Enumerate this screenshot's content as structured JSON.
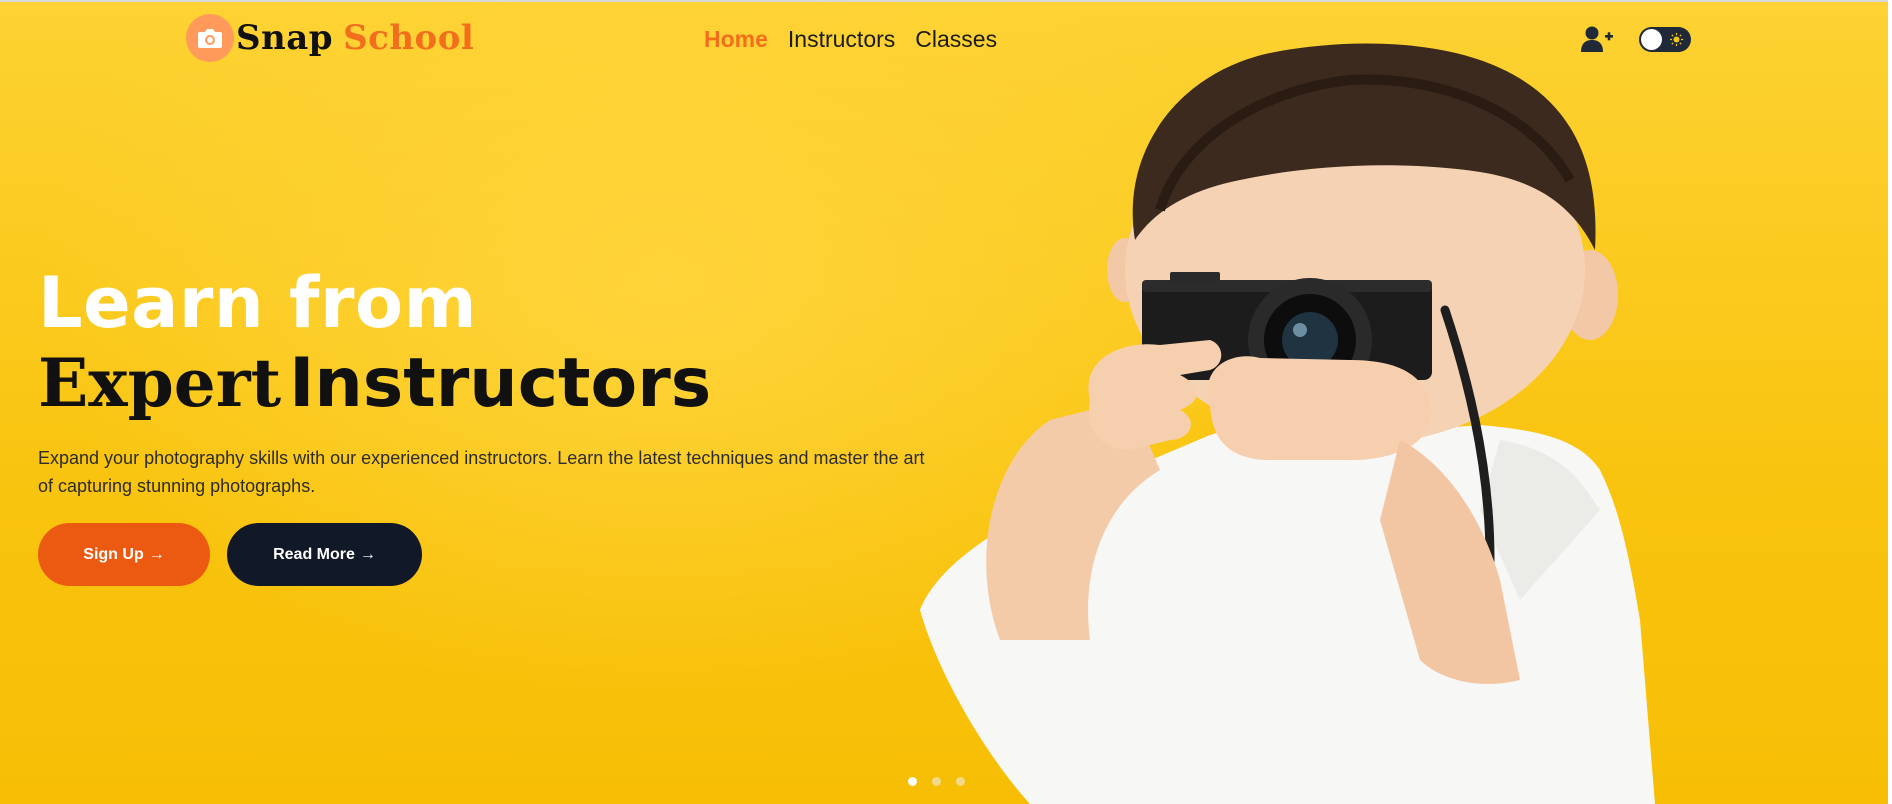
{
  "brand": {
    "name_part1": "Snap",
    "name_part2": "School",
    "badge_icon": "camera-icon",
    "badge_color": "#ff9a5a",
    "accent": "#f26e1d"
  },
  "nav": {
    "items": [
      {
        "label": "Home",
        "active": true
      },
      {
        "label": "Instructors",
        "active": false
      },
      {
        "label": "Classes",
        "active": false
      }
    ],
    "actions": {
      "signup_icon": "user-plus-icon",
      "theme_toggle_icon": "sun-icon"
    }
  },
  "hero": {
    "title_line1": "Learn from",
    "title_line2_serif": "Expert",
    "title_line2_sans": "Instructors",
    "description": "Expand your photography skills with our experienced instructors. Learn the latest techniques and master the art of capturing stunning photographs.",
    "buttons": {
      "signup": {
        "label": "Sign Up",
        "icon": "arrow-right-icon",
        "color": "#ec5a12"
      },
      "readmore": {
        "label": "Read More",
        "icon": "arrow-right-icon",
        "color": "#111827"
      }
    },
    "background_color": "#f9c40f",
    "slides": {
      "count": 3,
      "active_index": 0
    }
  }
}
